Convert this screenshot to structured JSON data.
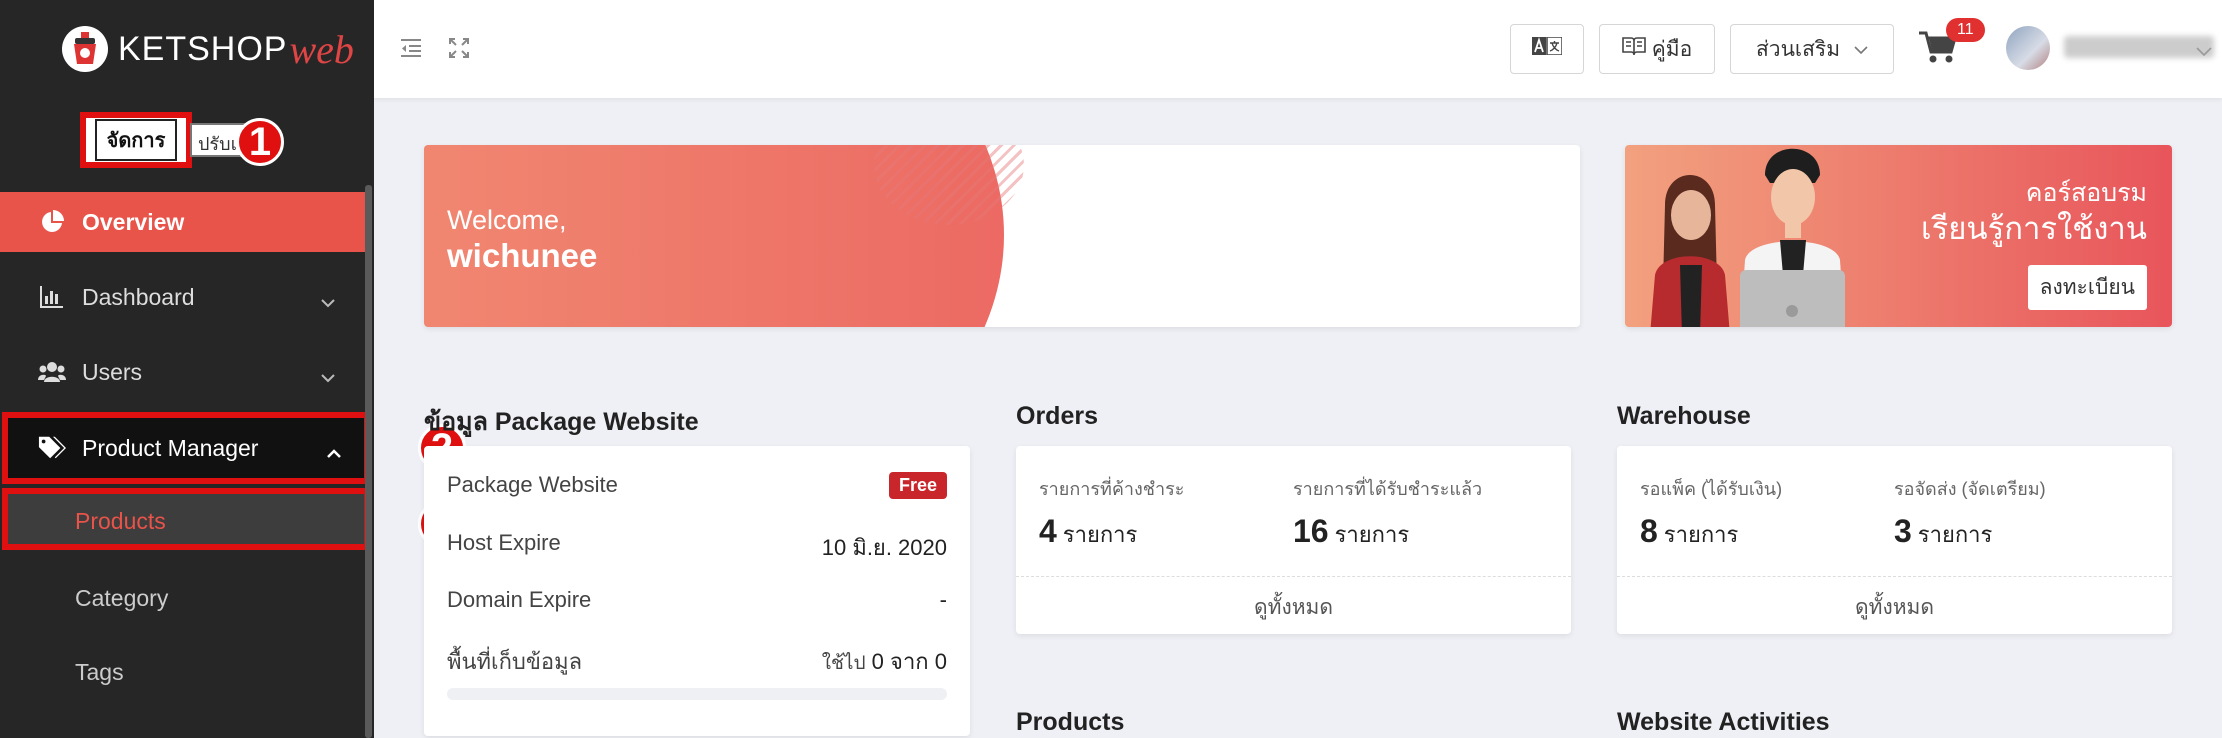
{
  "brand": {
    "name": "KETSHOP",
    "suffix": "web"
  },
  "mode_switch": {
    "manage_label": "จัดการ",
    "other_label": "ปรับแต่ง"
  },
  "callouts": [
    "1",
    "2",
    "3"
  ],
  "sidebar": {
    "items": [
      {
        "label": "Overview",
        "icon": "pie-chart-icon",
        "active": true
      },
      {
        "label": "Dashboard",
        "icon": "bar-chart-icon"
      },
      {
        "label": "Users",
        "icon": "users-icon"
      },
      {
        "label": "Product Manager",
        "icon": "tags-icon",
        "expanded": true
      }
    ],
    "subitems": [
      "Products",
      "Category",
      "Tags"
    ]
  },
  "header": {
    "manual_label": "คู่มือ",
    "addons_label": "ส่วนเสริม",
    "cart_count": "11"
  },
  "welcome": {
    "greeting": "Welcome,",
    "username": "wichunee"
  },
  "course_banner": {
    "line1": "คอร์สอบรม",
    "line2": "เรียนรู้การใช้งาน",
    "button": "ลงทะเบียน"
  },
  "package": {
    "title": "ข้อมูล Package Website",
    "name_label": "Package Website",
    "badge": "Free",
    "host_label": "Host Expire",
    "host_value": "10 มิ.ย. 2020",
    "domain_label": "Domain Expire",
    "domain_value": "-",
    "storage_label": "พื้นที่เก็บข้อมูล",
    "storage_used_label": "ใช้ไป",
    "storage_used": "0",
    "storage_of_label": "จาก",
    "storage_total": "0",
    "storage_fraction": 0
  },
  "orders": {
    "title": "Orders",
    "pending_label": "รายการที่ค้างชำระ",
    "pending_count": "4",
    "paid_label": "รายการที่ได้รับชำระแล้ว",
    "paid_count": "16",
    "unit": "รายการ",
    "view_all": "ดูทั้งหมด"
  },
  "warehouse": {
    "title": "Warehouse",
    "pack_label": "รอแพ็ค (ได้รับเงิน)",
    "pack_count": "8",
    "ship_label": "รอจัดส่ง (จัดเตรียม)",
    "ship_count": "3",
    "unit": "รายการ",
    "view_all": "ดูทั้งหมด"
  },
  "products_title": "Products",
  "activities_title": "Website Activities",
  "colors": {
    "accent": "#e8534a",
    "sidebar": "#262626",
    "highlight": "#e01010",
    "badge": "#c8262b"
  }
}
